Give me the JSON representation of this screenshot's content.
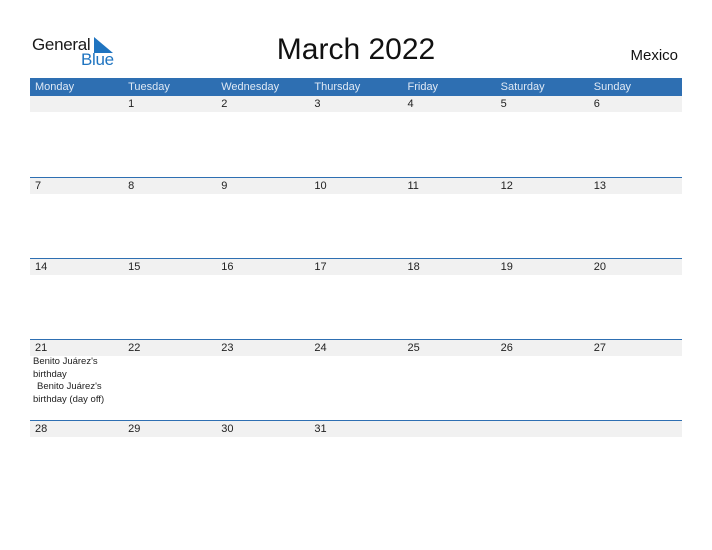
{
  "logo": {
    "general": "General",
    "blue": "Blue"
  },
  "title": "March 2022",
  "country": "Mexico",
  "weekdays": [
    "Monday",
    "Tuesday",
    "Wednesday",
    "Thursday",
    "Friday",
    "Saturday",
    "Sunday"
  ],
  "weeks": [
    {
      "days": [
        "",
        "1",
        "2",
        "3",
        "4",
        "5",
        "6"
      ],
      "events": [
        "",
        "",
        "",
        "",
        "",
        "",
        ""
      ]
    },
    {
      "days": [
        "7",
        "8",
        "9",
        "10",
        "11",
        "12",
        "13"
      ],
      "events": [
        "",
        "",
        "",
        "",
        "",
        "",
        ""
      ]
    },
    {
      "days": [
        "14",
        "15",
        "16",
        "17",
        "18",
        "19",
        "20"
      ],
      "events": [
        "",
        "",
        "",
        "",
        "",
        "",
        ""
      ]
    },
    {
      "days": [
        "21",
        "22",
        "23",
        "24",
        "25",
        "26",
        "27"
      ],
      "events": [
        "Benito Juárez's birthday",
        "",
        "",
        "",
        "",
        "",
        ""
      ],
      "events2": [
        "Benito Juárez's birthday (day off)"
      ]
    },
    {
      "days": [
        "28",
        "29",
        "30",
        "31",
        "",
        "",
        ""
      ],
      "events": [
        "",
        "",
        "",
        "",
        "",
        "",
        ""
      ]
    }
  ],
  "colors": {
    "header": "#2e6fb2",
    "brand_blue": "#1f74c0",
    "row_bg": "#f1f1f1"
  }
}
